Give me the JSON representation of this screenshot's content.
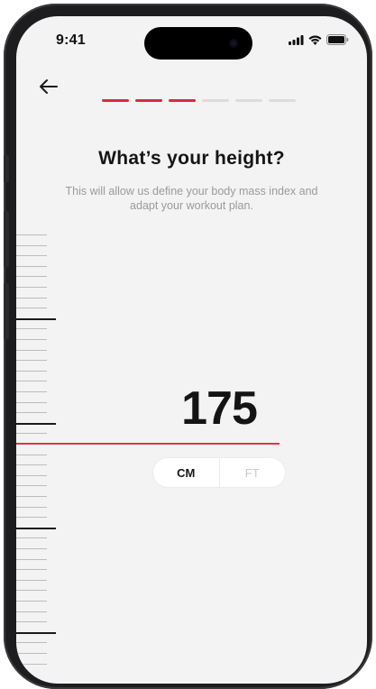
{
  "status_bar": {
    "time": "9:41",
    "icons": [
      "signal-icon",
      "wifi-icon",
      "battery-icon"
    ]
  },
  "navigation": {
    "back_icon": "arrow-left-icon"
  },
  "progress": {
    "total_steps": 6,
    "completed_steps": 3,
    "active_color": "#e0283a",
    "inactive_color": "#dcdcdc"
  },
  "header": {
    "title": "What’s your height?",
    "subtitle": "This will allow us define your body mass index and adapt your workout plan."
  },
  "height_picker": {
    "value": "175",
    "indicator_color": "#d9384a",
    "units": [
      {
        "label": "CM",
        "selected": true
      },
      {
        "label": "FT",
        "selected": false
      }
    ]
  }
}
